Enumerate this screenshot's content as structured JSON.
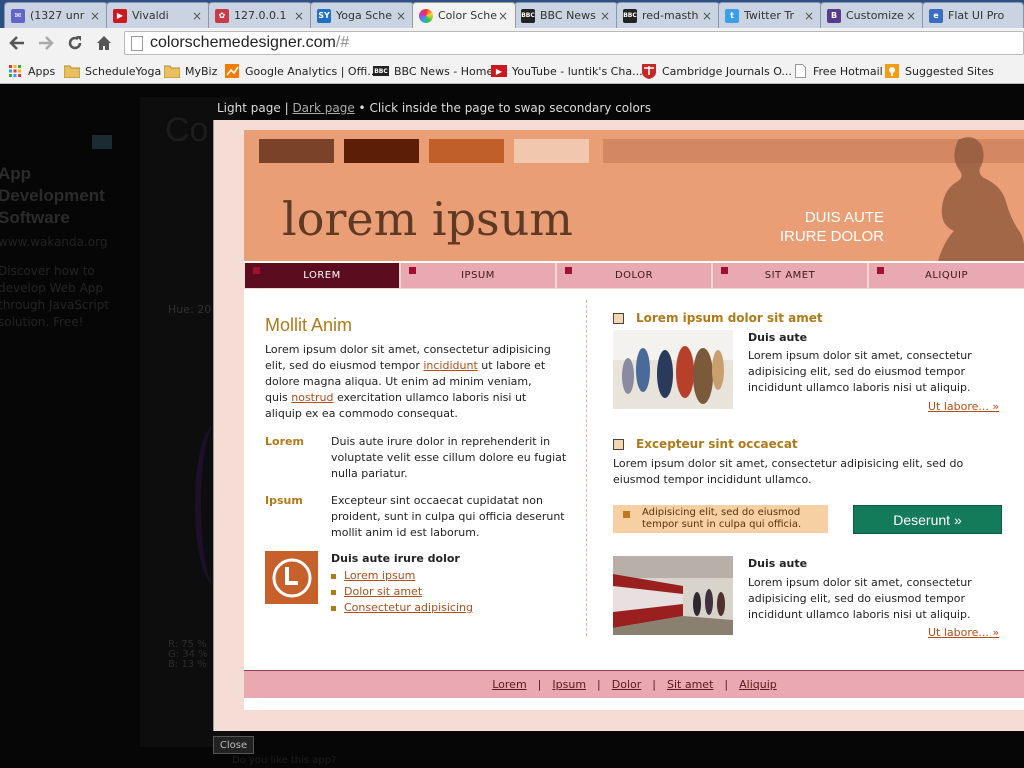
{
  "tabs": [
    {
      "label": "(1327 unr",
      "icon": "mail-icon",
      "color": "#6264c8"
    },
    {
      "label": "Vivaldi",
      "icon": "youtube-icon",
      "color": "#cc181e"
    },
    {
      "label": "127.0.0.1",
      "icon": "app-icon",
      "color": "#c83c4a"
    },
    {
      "label": "Yoga Sche",
      "icon": "sy-icon",
      "color": "#1f70c1"
    },
    {
      "label": "Color Sche",
      "icon": "color-wheel-icon",
      "color": "#e8a020"
    },
    {
      "label": "BBC News",
      "icon": "bbc-icon",
      "color": "#222222"
    },
    {
      "label": "red-masth",
      "icon": "bbc-icon",
      "color": "#222222"
    },
    {
      "label": "Twitter Tr",
      "icon": "twitter-icon",
      "color": "#3a9ee8"
    },
    {
      "label": "Customize",
      "icon": "bootstrap-icon",
      "color": "#5b3a8e"
    },
    {
      "label": "Flat UI Pro",
      "icon": "page-icon",
      "color": "#3a6cc0"
    }
  ],
  "omnibox": {
    "host": "colorschemedesigner.com",
    "path": "/#"
  },
  "bookmarks": [
    {
      "label": "Apps",
      "icon": "apps-grid-icon"
    },
    {
      "label": "ScheduleYoga",
      "icon": "folder-icon"
    },
    {
      "label": "MyBiz",
      "icon": "folder-icon"
    },
    {
      "label": "Google Analytics | Offi...",
      "icon": "analytics-icon"
    },
    {
      "label": "BBC News - Home",
      "icon": "bbc-icon"
    },
    {
      "label": "YouTube - luntik's Cha...",
      "icon": "youtube-icon"
    },
    {
      "label": "Cambridge Journals O...",
      "icon": "cambridge-icon"
    },
    {
      "label": "Free Hotmail",
      "icon": "page-icon"
    },
    {
      "label": "Suggested Sites",
      "icon": "suggested-icon"
    }
  ],
  "background": {
    "ad_title": "App Development Software",
    "ad_url": "www.wakanda.org",
    "ad_text": "Discover how to develop Web App through JavaScript solution. Free!",
    "big_text": "Co",
    "hue": "Hue: 20",
    "rgb": "R: 75 %\nG: 34 %\nB: 13 %"
  },
  "preview_header": {
    "light_page": "Light page",
    "separator": "|",
    "dark_page": "Dark page",
    "bullet": "•",
    "hint": "Click inside the page to swap secondary colors"
  },
  "banner": {
    "logo": "lorem ipsum",
    "slogan_line1": "DUIS AUTE",
    "slogan_line2": "IRURE DOLOR",
    "swatches": [
      "#7a4228",
      "#5c1e06",
      "#c05f2a",
      "#f1c7ae"
    ],
    "background": "#ea9e76"
  },
  "nav": [
    "LOREM",
    "IPSUM",
    "DOLOR",
    "SIT AMET",
    "ALIQUIP"
  ],
  "left": {
    "title": "Mollit Anim",
    "intro_1": "Lorem ipsum dolor sit amet, consectetur adipisicing",
    "intro_2a": "elit, sed do eiusmod tempor",
    "intro_link1": "incididunt",
    "intro_2b": "ut labore et",
    "intro_3": "dolore magna aliqua. Ut enim ad minim veniam,",
    "intro_4a": "quis",
    "intro_link2": "nostrud",
    "intro_4b": "exercitation ullamco laboris nisi ut",
    "intro_5": "aliquip ex ea commodo consequat.",
    "defs": [
      {
        "term": "Lorem",
        "text": "Duis aute irure dolor in reprehenderit in voluptate velit esse cillum dolore eu fugiat nulla pariatur."
      },
      {
        "term": "Ipsum",
        "text": "Excepteur sint occaecat cupidatat non proident, sunt in culpa qui officia deserunt mollit anim id est laborum."
      }
    ],
    "list_title": "Duis aute irure dolor",
    "list": [
      "Lorem ipsum",
      "Dolor sit amet",
      "Consectetur adipisicing"
    ]
  },
  "right": {
    "heading1": "Lorem ipsum dolor sit amet",
    "sub1": "Duis aute",
    "text1": "Lorem ipsum dolor sit amet, consectetur adipisicing elit, sed do eiusmod tempor incididunt ullamco laboris nisi ut aliquip.",
    "more1": "Ut labore... »",
    "heading2": "Excepteur sint occaecat",
    "text2": "Lorem ipsum dolor sit amet, consectetur adipisicing elit, sed do eiusmod tempor incididunt ullamco.",
    "callout": "Adipisicing elit, sed do eiusmod tempor sunt in culpa qui officia.",
    "button": "Deserunt »",
    "sub3": "Duis aute",
    "text3": "Lorem ipsum dolor sit amet, consectetur adipisicing elit, sed do eiusmod tempor incididunt ullamco laboris nisi ut aliquip.",
    "more3": "Ut labore... »"
  },
  "footer": [
    "Lorem",
    "Ipsum",
    "Dolor",
    "Sit amet",
    "Aliquip"
  ],
  "close_label": "Close",
  "bottom_question": "Do you like this app?"
}
